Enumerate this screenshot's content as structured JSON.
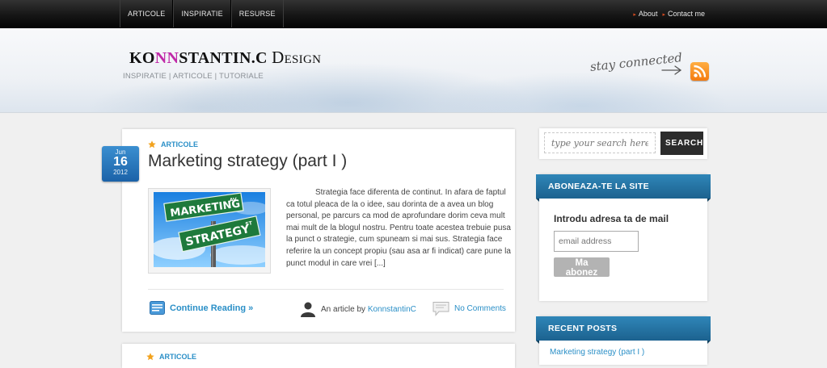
{
  "nav": {
    "items": [
      "ARTICOLE",
      "INSPIRATIE",
      "RESURSE"
    ],
    "right": [
      "About",
      "Contact me"
    ]
  },
  "header": {
    "logo_part1": "KO",
    "logo_highlight": "NN",
    "logo_part2": "STANTIN.C",
    "logo_design": "Design",
    "tagline": "INSPIRATIE | ARTICOLE | TUTORIALE",
    "stay_connected": "stay connected"
  },
  "post": {
    "date": {
      "month": "Jun",
      "day": "16",
      "year": "2012"
    },
    "category": "ARTICOLE",
    "title": "Marketing strategy (part I )",
    "thumb_sign_top": "MARKETING",
    "thumb_sign_top_small": "AV",
    "thumb_sign_bottom": "STRATEGY",
    "thumb_sign_bottom_small": "ST",
    "excerpt": "Strategia face diferenta de continut. In afara de faptul ca totul pleaca de la o idee, sau dorinta de a avea un blog personal, pe parcurs ca mod de aprofundare dorim ceva mult mai mult de la blogul nostru. Pentru toate acestea trebuie pusa la punct o strategie, cum spuneam si mai sus. Strategia face referire la un concept propiu (sau asa ar fi indicat) care pune la punct modul in care vrei [...]",
    "continue": "Continue Reading »",
    "by_prefix": "An article by",
    "author": "KonnstantinC",
    "comments": "No Comments"
  },
  "next_post": {
    "category": "ARTICOLE"
  },
  "sidebar": {
    "search_placeholder": "type your search here",
    "search_button": "SEARCH",
    "subscribe_title": "ABONEAZA-TE LA SITE",
    "subscribe_heading": "Introdu adresa ta de mail",
    "email_placeholder": "email address",
    "subscribe_button": "Ma abonez",
    "recent_title": "RECENT POSTS",
    "recent_items": [
      "Marketing strategy (part I )"
    ]
  },
  "colors": {
    "accent": "#2a8fc7",
    "logo_highlight": "#c02aa8",
    "ribbon": "#2f86b8",
    "rss": "#f47b10"
  }
}
